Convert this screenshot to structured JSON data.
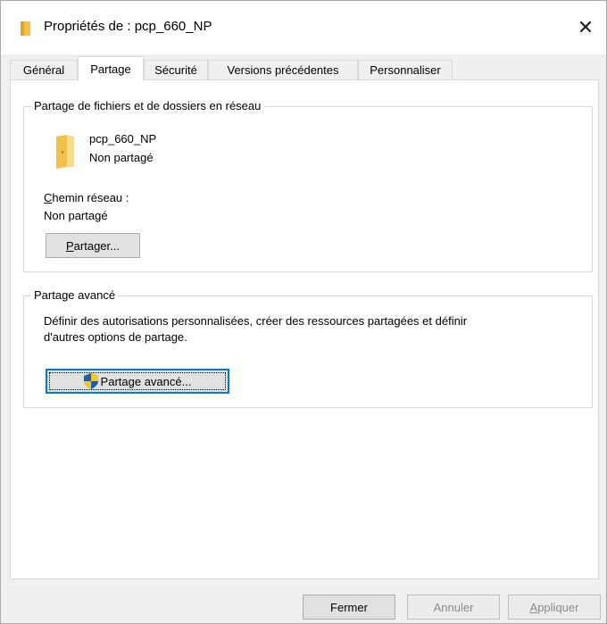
{
  "window": {
    "title": "Propriétés de : pcp_660_NP",
    "close_glyph": "✕"
  },
  "tabs": [
    {
      "label": "Général",
      "active": false
    },
    {
      "label": "Partage",
      "active": true
    },
    {
      "label": "Sécurité",
      "active": false
    },
    {
      "label": "Versions précédentes",
      "active": false
    },
    {
      "label": "Personnaliser",
      "active": false
    }
  ],
  "network_sharing": {
    "group_title": "Partage de fichiers et de dossiers en réseau",
    "folder_name": "pcp_660_NP",
    "folder_status": "Non partagé",
    "path_label_prefix": "C",
    "path_label_rest": "hemin réseau :",
    "path_value": "Non partagé",
    "share_button_prefix": "P",
    "share_button_rest": "artager..."
  },
  "advanced_sharing": {
    "group_title": "Partage avancé",
    "description_line1": "Définir des autorisations personnalisées, créer des ressources partagées et définir",
    "description_line2": "d'autres options de partage.",
    "button_label": "Partage avancé..."
  },
  "footer": {
    "close_label": "Fermer",
    "cancel_label": "Annuler",
    "apply_prefix": "A",
    "apply_rest": "ppliquer"
  },
  "icons": {
    "title_icon": "folder-icon",
    "folder_icon": "folder-icon",
    "shield_icon": "uac-shield-icon"
  },
  "colors": {
    "accent": "#0078d7",
    "folder": "#f5d57a",
    "background": "#f0f0f0"
  }
}
